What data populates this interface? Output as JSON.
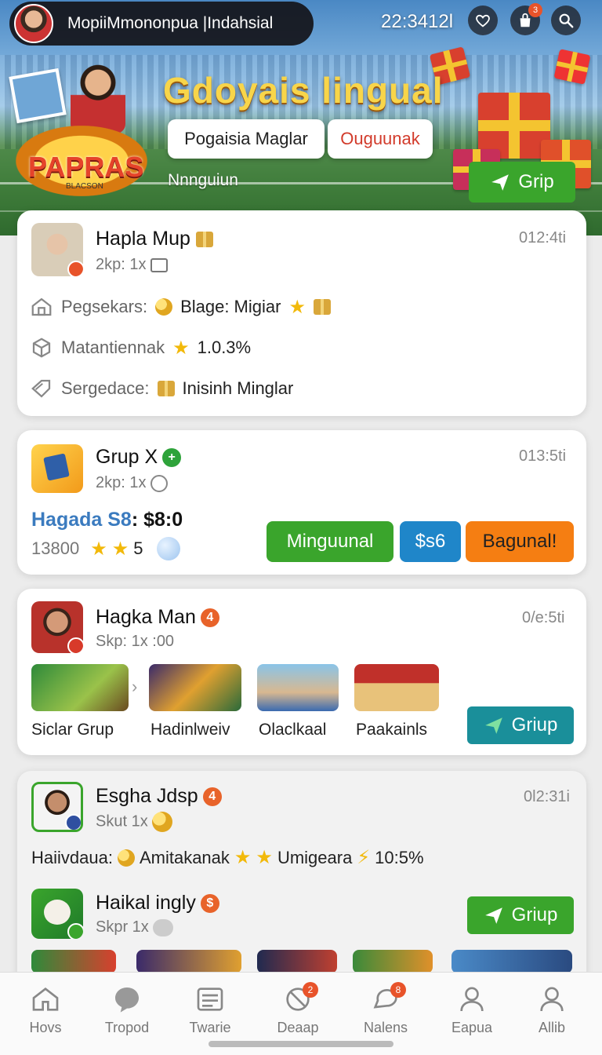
{
  "header": {
    "user_name": "MopiiMmononpua |Indahsial",
    "clock": "22:3412l",
    "cart_badge": "3",
    "banner_title": "Gdoyais lingual",
    "seg_left": "Pogaisia Maglar",
    "seg_right": "Ouguunak",
    "banner_sub": "Nnnguiun",
    "logo_text": "PAPRAS",
    "logo_sub": "BLACSON",
    "grip_button": "Grip"
  },
  "cards": {
    "c1": {
      "title": "Hapla Mup",
      "sub": "2kp: 1x",
      "time": "012:4ti",
      "row1_label": "Pegsekars:",
      "row1_value": "Blage: Migiar",
      "row2_label": "Matantiennak",
      "row2_value": "1.0.3%",
      "row3_label": "Sergedace:",
      "row3_value": "Inisinh Minglar"
    },
    "c2": {
      "title": "Grup X",
      "sub": "2kp: 1x",
      "time": "013:5ti",
      "price_label": "Hagada S8",
      "price_value": ": $8:0",
      "count": "13800",
      "count_suffix": "5",
      "btn_green": "Minguunal",
      "btn_blue": "$s6",
      "btn_orange": "Bagunal!"
    },
    "c3": {
      "title": "Hagka Man",
      "badge": "4",
      "sub": "Skp: 1x :00",
      "time": "0/e:5ti",
      "tiles": [
        "Siclar Grup",
        "Hadinlweiv",
        "Olaclkaal",
        "Paakainls"
      ],
      "button": "Griup"
    },
    "c4": {
      "title": "Esgha Jdsp",
      "badge": "4",
      "sub": "Skut 1x",
      "time": "0l2:31i",
      "row_label": "Haiivdaua:",
      "row_value1": "Amitakanak",
      "row_value2": "Umigeara",
      "row_value3": "10:5%",
      "sub_title": "Haikal ingly",
      "sub_sub": "Skpr 1x",
      "sub_button": "Griup"
    }
  },
  "nav": {
    "items": [
      "Hovs",
      "Tropod",
      "Twarie",
      "Deaap",
      "Nalens",
      "Eapua",
      "Allib"
    ],
    "badge_deaap": "2",
    "badge_nalens": "8"
  },
  "colors": {
    "green": "#3aa52c",
    "blue": "#1f86c9",
    "orange": "#f57e12",
    "teal": "#1a8f9a",
    "red_badge": "#e8532a"
  }
}
